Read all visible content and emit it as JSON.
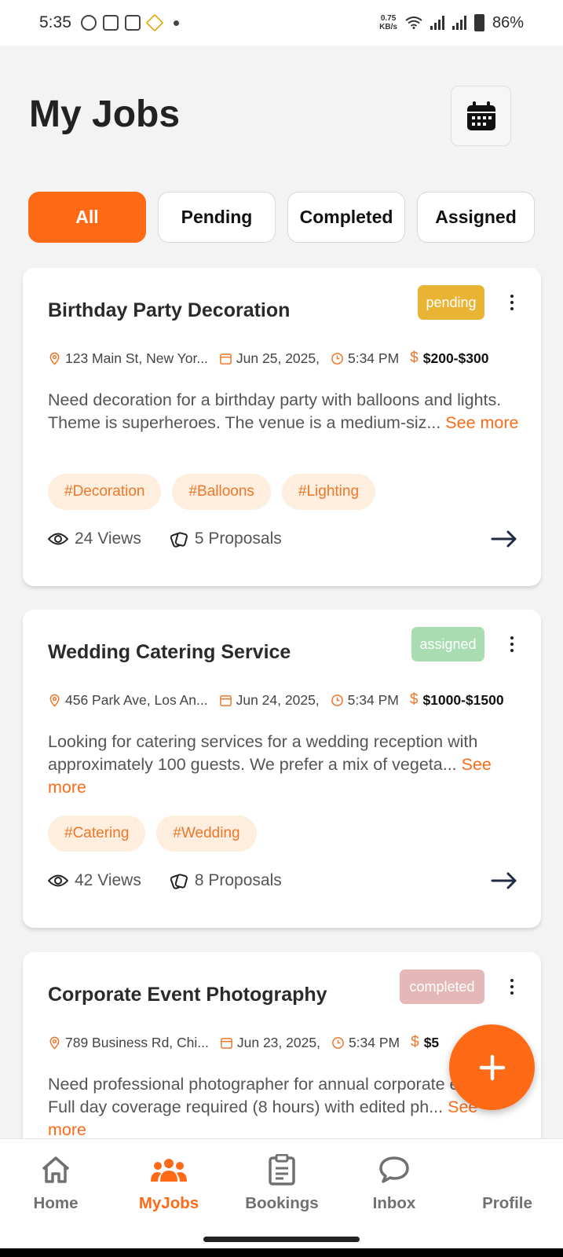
{
  "status_bar": {
    "time": "5:35",
    "speed_value": "0.75",
    "speed_unit": "KB/s",
    "battery": "86%"
  },
  "header": {
    "title": "My Jobs",
    "calendar_icon": "calendar-icon"
  },
  "tabs": [
    {
      "label": "All",
      "active": true
    },
    {
      "label": "Pending",
      "active": false
    },
    {
      "label": "Completed",
      "active": false
    },
    {
      "label": "Assigned",
      "active": false
    }
  ],
  "colors": {
    "accent": "#ff6a17",
    "pending": "#e9b434",
    "assigned": "#a9dcb0",
    "completed": "#e4b7b9"
  },
  "jobs": [
    {
      "title": "Birthday Party Decoration",
      "status": "pending",
      "location": "123 Main St, New Yor...",
      "date": "Jun 25, 2025,",
      "time": "5:34 PM",
      "price": "$200-$300",
      "description": "Need decoration for a birthday party with balloons and lights. Theme is superheroes. The venue is a medium-siz...",
      "see_more": "See more",
      "tags": [
        "#Decoration",
        "#Balloons",
        "#Lighting"
      ],
      "views": "24 Views",
      "proposals": "5 Proposals"
    },
    {
      "title": "Wedding Catering Service",
      "status": "assigned",
      "location": "456 Park Ave, Los An...",
      "date": "Jun 24, 2025,",
      "time": "5:34 PM",
      "price": "$1000-$1500",
      "description": "Looking for catering services for a wedding reception with approximately 100 guests. We prefer a mix of vegeta...",
      "see_more": "See more",
      "tags": [
        "#Catering",
        "#Wedding"
      ],
      "views": "42 Views",
      "proposals": "8 Proposals"
    },
    {
      "title": "Corporate Event Photography",
      "status": "completed",
      "location": "789 Business Rd, Chi...",
      "date": "Jun 23, 2025,",
      "time": "5:34 PM",
      "price": "$5",
      "description": "Need professional photographer for annual corporate event. Full day coverage required (8 hours) with edited ph...",
      "see_more": "See more"
    }
  ],
  "fab": {
    "icon": "plus-icon"
  },
  "bottom_nav": [
    {
      "label": "Home",
      "icon": "home-icon",
      "active": false
    },
    {
      "label": "MyJobs",
      "icon": "people-icon",
      "active": true
    },
    {
      "label": "Bookings",
      "icon": "clipboard-icon",
      "active": false
    },
    {
      "label": "Inbox",
      "icon": "chat-bubble-icon",
      "active": false
    },
    {
      "label": "Profile",
      "icon": "profile-icon",
      "active": false
    }
  ]
}
